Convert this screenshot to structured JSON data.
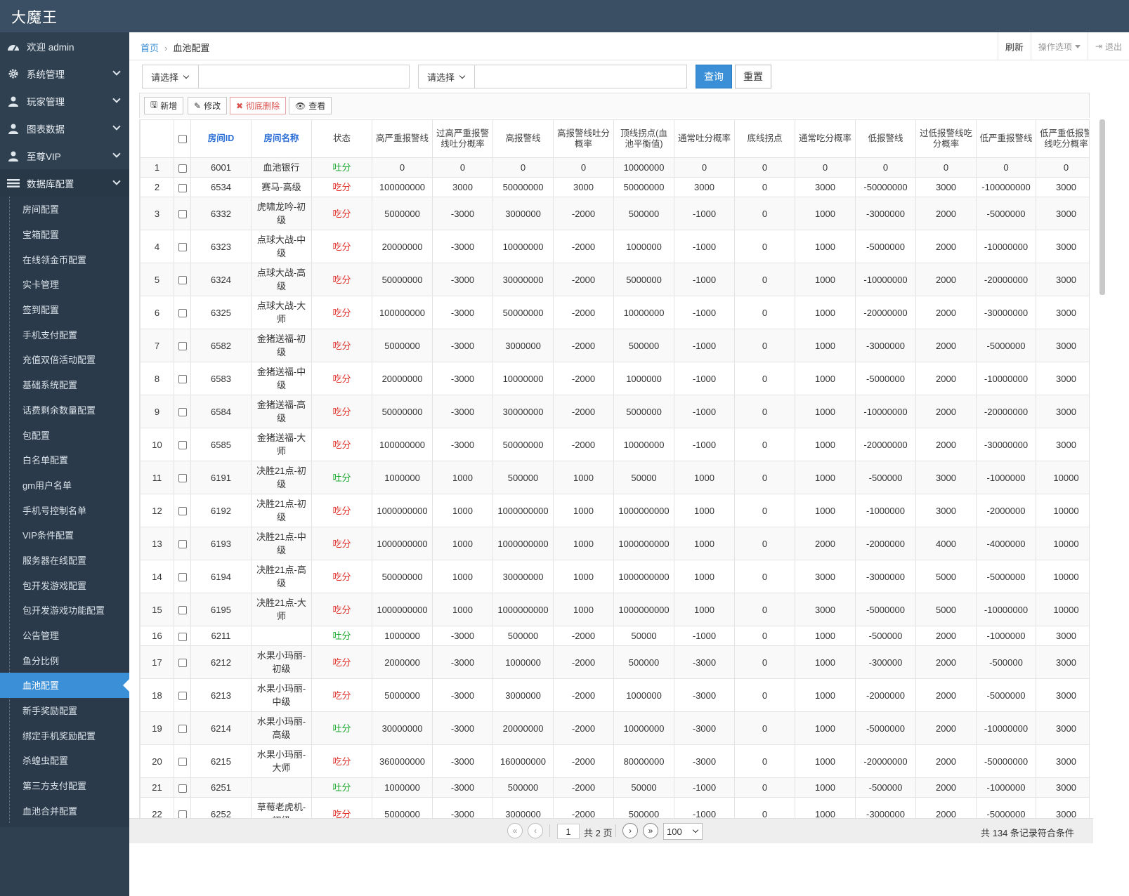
{
  "app": {
    "title": "大魔王"
  },
  "sidebar": {
    "welcome": "欢迎 admin",
    "menus": [
      {
        "label": "系统管理",
        "icon": "gear-icon"
      },
      {
        "label": "玩家管理",
        "icon": "user-icon"
      },
      {
        "label": "图表数据",
        "icon": "user-icon"
      },
      {
        "label": "至尊VIP",
        "icon": "user-icon"
      }
    ],
    "open_menu": {
      "label": "数据库配置",
      "icon": "list-icon"
    },
    "sub_items": [
      "房间配置",
      "宝箱配置",
      "在线领金币配置",
      "实卡管理",
      "签到配置",
      "手机支付配置",
      "充值双倍活动配置",
      "基础系统配置",
      "话费剩余数量配置",
      "包配置",
      "白名单配置",
      "gm用户名单",
      "手机号控制名单",
      "VIP条件配置",
      "服务器在线配置",
      "包开发游戏配置",
      "包开发游戏功能配置",
      "公告管理",
      "鱼分比例",
      "血池配置",
      "新手奖励配置",
      "绑定手机奖励配置",
      "杀蝗虫配置",
      "第三方支付配置",
      "血池合并配置"
    ],
    "active_sub": "血池配置"
  },
  "breadcrumb": {
    "home": "首页",
    "sep": "›",
    "current": "血池配置"
  },
  "topright": {
    "refresh": "刷新",
    "options": "操作选项",
    "logout": "退出"
  },
  "filters": {
    "select1": "请选择",
    "input1": "",
    "select2": "请选择",
    "input2": "",
    "query": "查询",
    "reset": "重置"
  },
  "toolbar": {
    "add": "新增",
    "edit": "修改",
    "delete": "彻底删除",
    "view": "查看"
  },
  "table": {
    "columns": [
      "房间ID",
      "房间名称",
      "状态",
      "高严重报警线",
      "过高严重报警线吐分概率",
      "高报警线",
      "高报警线吐分概率",
      "顶线拐点(血池平衡值)",
      "通常吐分概率",
      "底线拐点",
      "通常吃分概率",
      "低报警线",
      "过低报警线吃分概率",
      "低严重报警线",
      "低严重低报警线吃分概率"
    ],
    "rows": [
      {
        "n": "1",
        "id": "6001",
        "name": "血池银行",
        "status": "吐分",
        "v": [
          "0",
          "0",
          "0",
          "0",
          "10000000",
          "0",
          "0",
          "0",
          "0",
          "0",
          "0",
          "0"
        ]
      },
      {
        "n": "2",
        "id": "6534",
        "name": "赛马-高级",
        "status": "吃分",
        "v": [
          "100000000",
          "3000",
          "50000000",
          "3000",
          "50000000",
          "3000",
          "0",
          "3000",
          "-50000000",
          "3000",
          "-100000000",
          "3000"
        ]
      },
      {
        "n": "3",
        "id": "6332",
        "name": "虎啸龙吟-初级",
        "status": "吃分",
        "v": [
          "5000000",
          "-3000",
          "3000000",
          "-2000",
          "500000",
          "-1000",
          "0",
          "1000",
          "-3000000",
          "2000",
          "-5000000",
          "3000"
        ]
      },
      {
        "n": "4",
        "id": "6323",
        "name": "点球大战-中级",
        "status": "吃分",
        "v": [
          "20000000",
          "-3000",
          "10000000",
          "-2000",
          "1000000",
          "-1000",
          "0",
          "1000",
          "-5000000",
          "2000",
          "-10000000",
          "3000"
        ]
      },
      {
        "n": "5",
        "id": "6324",
        "name": "点球大战-高级",
        "status": "吃分",
        "v": [
          "50000000",
          "-3000",
          "30000000",
          "-2000",
          "5000000",
          "-1000",
          "0",
          "1000",
          "-10000000",
          "2000",
          "-20000000",
          "3000"
        ]
      },
      {
        "n": "6",
        "id": "6325",
        "name": "点球大战-大师",
        "status": "吃分",
        "v": [
          "100000000",
          "-3000",
          "50000000",
          "-2000",
          "10000000",
          "-1000",
          "0",
          "1000",
          "-20000000",
          "2000",
          "-30000000",
          "3000"
        ]
      },
      {
        "n": "7",
        "id": "6582",
        "name": "金猪送福-初级",
        "status": "吃分",
        "v": [
          "5000000",
          "-3000",
          "3000000",
          "-2000",
          "500000",
          "-1000",
          "0",
          "1000",
          "-3000000",
          "2000",
          "-5000000",
          "3000"
        ]
      },
      {
        "n": "8",
        "id": "6583",
        "name": "金猪送福-中级",
        "status": "吃分",
        "v": [
          "20000000",
          "-3000",
          "10000000",
          "-2000",
          "1000000",
          "-1000",
          "0",
          "1000",
          "-5000000",
          "2000",
          "-10000000",
          "3000"
        ]
      },
      {
        "n": "9",
        "id": "6584",
        "name": "金猪送福-高级",
        "status": "吃分",
        "v": [
          "50000000",
          "-3000",
          "30000000",
          "-2000",
          "5000000",
          "-1000",
          "0",
          "1000",
          "-10000000",
          "2000",
          "-20000000",
          "3000"
        ]
      },
      {
        "n": "10",
        "id": "6585",
        "name": "金猪送福-大师",
        "status": "吃分",
        "v": [
          "100000000",
          "-3000",
          "50000000",
          "-2000",
          "10000000",
          "-1000",
          "0",
          "1000",
          "-20000000",
          "2000",
          "-30000000",
          "3000"
        ]
      },
      {
        "n": "11",
        "id": "6191",
        "name": "决胜21点-初级",
        "status": "吐分",
        "v": [
          "1000000",
          "1000",
          "500000",
          "1000",
          "50000",
          "1000",
          "0",
          "1000",
          "-500000",
          "3000",
          "-1000000",
          "10000"
        ]
      },
      {
        "n": "12",
        "id": "6192",
        "name": "决胜21点-初级",
        "status": "吃分",
        "v": [
          "1000000000",
          "1000",
          "1000000000",
          "1000",
          "1000000000",
          "1000",
          "0",
          "1000",
          "-1000000",
          "3000",
          "-2000000",
          "10000"
        ]
      },
      {
        "n": "13",
        "id": "6193",
        "name": "决胜21点-中级",
        "status": "吃分",
        "v": [
          "1000000000",
          "1000",
          "1000000000",
          "1000",
          "1000000000",
          "1000",
          "0",
          "2000",
          "-2000000",
          "4000",
          "-4000000",
          "10000"
        ]
      },
      {
        "n": "14",
        "id": "6194",
        "name": "决胜21点-高级",
        "status": "吃分",
        "v": [
          "50000000",
          "1000",
          "30000000",
          "1000",
          "1000000000",
          "1000",
          "0",
          "3000",
          "-3000000",
          "5000",
          "-5000000",
          "10000"
        ]
      },
      {
        "n": "15",
        "id": "6195",
        "name": "决胜21点-大师",
        "status": "吃分",
        "v": [
          "1000000000",
          "1000",
          "1000000000",
          "1000",
          "1000000000",
          "1000",
          "0",
          "3000",
          "-5000000",
          "5000",
          "-10000000",
          "10000"
        ]
      },
      {
        "n": "16",
        "id": "6211",
        "name": "",
        "status": "吐分",
        "v": [
          "1000000",
          "-3000",
          "500000",
          "-2000",
          "50000",
          "-1000",
          "0",
          "1000",
          "-500000",
          "2000",
          "-1000000",
          "3000"
        ]
      },
      {
        "n": "17",
        "id": "6212",
        "name": "水果小玛丽-初级",
        "status": "吃分",
        "v": [
          "2000000",
          "-3000",
          "1000000",
          "-2000",
          "500000",
          "-3000",
          "0",
          "1000",
          "-300000",
          "2000",
          "-500000",
          "3000"
        ]
      },
      {
        "n": "18",
        "id": "6213",
        "name": "水果小玛丽-中级",
        "status": "吃分",
        "v": [
          "5000000",
          "-3000",
          "3000000",
          "-2000",
          "1000000",
          "-3000",
          "0",
          "1000",
          "-2000000",
          "2000",
          "-5000000",
          "3000"
        ]
      },
      {
        "n": "19",
        "id": "6214",
        "name": "水果小玛丽-高级",
        "status": "吐分",
        "v": [
          "30000000",
          "-3000",
          "20000000",
          "-2000",
          "10000000",
          "-3000",
          "0",
          "1000",
          "-5000000",
          "2000",
          "-10000000",
          "3000"
        ]
      },
      {
        "n": "20",
        "id": "6215",
        "name": "水果小玛丽-大师",
        "status": "吃分",
        "v": [
          "360000000",
          "-3000",
          "160000000",
          "-2000",
          "80000000",
          "-3000",
          "0",
          "1000",
          "-20000000",
          "2000",
          "-50000000",
          "3000"
        ]
      },
      {
        "n": "21",
        "id": "6251",
        "name": "",
        "status": "吐分",
        "v": [
          "1000000",
          "-3000",
          "500000",
          "-2000",
          "50000",
          "-1000",
          "0",
          "1000",
          "-500000",
          "2000",
          "-1000000",
          "3000"
        ]
      },
      {
        "n": "22",
        "id": "6252",
        "name": "草莓老虎机-初级",
        "status": "吃分",
        "v": [
          "5000000",
          "-3000",
          "3000000",
          "-2000",
          "500000",
          "-1000",
          "0",
          "1000",
          "-3000000",
          "2000",
          "-5000000",
          "3000"
        ]
      }
    ]
  },
  "pager": {
    "page": "1",
    "total_pages": "共 2 页",
    "page_size": "100",
    "info": "共 134 条记录符合条件"
  },
  "colors": {
    "header": "#3a4f63",
    "sidebar": "#2f4050",
    "accent": "#3a8fd6",
    "eat": "#e0322b",
    "spit": "#1aa82e"
  }
}
